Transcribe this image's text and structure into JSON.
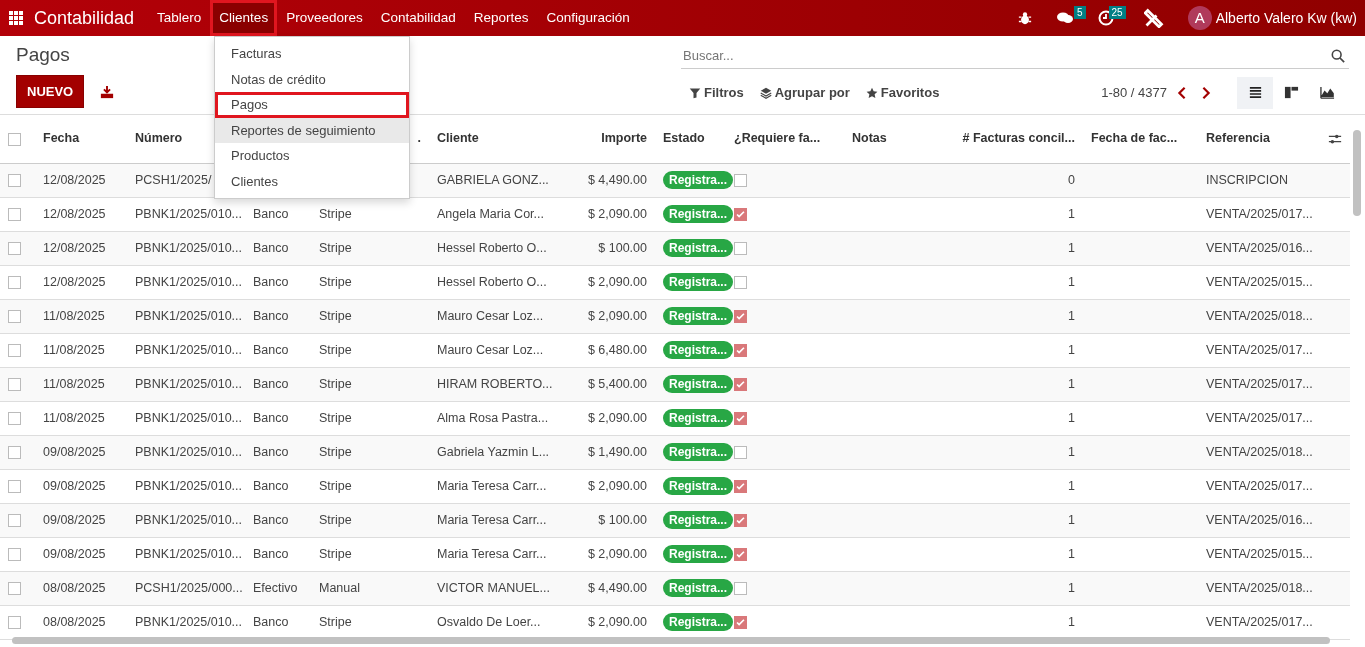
{
  "navbar": {
    "app_title": "Contabilidad",
    "menu": [
      {
        "label": "Tablero",
        "selected": false,
        "highlighted": false
      },
      {
        "label": "Clientes",
        "selected": true,
        "highlighted": true
      },
      {
        "label": "Proveedores",
        "selected": false,
        "highlighted": false
      },
      {
        "label": "Contabilidad",
        "selected": false,
        "highlighted": false
      },
      {
        "label": "Reportes",
        "selected": false,
        "highlighted": false
      },
      {
        "label": "Configuración",
        "selected": false,
        "highlighted": false
      }
    ],
    "messages_badge": "5",
    "activities_badge": "25",
    "avatar_initial": "A",
    "user": "Alberto Valero Kw (kw)"
  },
  "dropdown": {
    "items": [
      {
        "label": "Facturas",
        "hovered": false,
        "highlighted": false
      },
      {
        "label": "Notas de crédito",
        "hovered": false,
        "highlighted": false
      },
      {
        "label": "Pagos",
        "hovered": false,
        "highlighted": true
      },
      {
        "label": "Reportes de seguimiento",
        "hovered": true,
        "highlighted": false
      },
      {
        "label": "Productos",
        "hovered": false,
        "highlighted": false
      },
      {
        "label": "Clientes",
        "hovered": false,
        "highlighted": false
      }
    ]
  },
  "control_panel": {
    "title": "Pagos",
    "new_button": "NUEVO",
    "search": {
      "placeholder": "Buscar..."
    },
    "filters": [
      "Filtros",
      "Agrupar por",
      "Favoritos"
    ],
    "pager": "1-80 / 4377",
    "views": [
      {
        "kind": "list",
        "selected": true
      },
      {
        "kind": "kanban",
        "selected": false
      },
      {
        "kind": "graph",
        "selected": false
      }
    ]
  },
  "table": {
    "all_selected": false,
    "columns": [
      "Fecha",
      "Número",
      "",
      ".",
      "Cliente",
      "Importe",
      "Estado",
      "¿Requiere fa...",
      "Notas",
      "# Facturas concil...",
      "Fecha de fac...",
      "Referencia"
    ],
    "rows": [
      {
        "selected": false,
        "date": "12/08/2025",
        "number": "PCSH1/2025/",
        "journal": "",
        "method": "",
        "client": "GABRIELA GONZ...",
        "amount": "$ 4,490.00",
        "status": "Registra...",
        "requires_invoice": false,
        "reconciled": "0",
        "reference": "INSCRIPCION"
      },
      {
        "selected": false,
        "date": "12/08/2025",
        "number": "PBNK1/2025/010...",
        "journal": "Banco",
        "method": "Stripe",
        "client": "Angela Maria Cor...",
        "amount": "$ 2,090.00",
        "status": "Registra...",
        "requires_invoice": true,
        "reconciled": "1",
        "reference": "VENTA/2025/017..."
      },
      {
        "selected": false,
        "date": "12/08/2025",
        "number": "PBNK1/2025/010...",
        "journal": "Banco",
        "method": "Stripe",
        "client": "Hessel Roberto O...",
        "amount": "$ 100.00",
        "status": "Registra...",
        "requires_invoice": false,
        "reconciled": "1",
        "reference": "VENTA/2025/016..."
      },
      {
        "selected": false,
        "date": "12/08/2025",
        "number": "PBNK1/2025/010...",
        "journal": "Banco",
        "method": "Stripe",
        "client": "Hessel Roberto O...",
        "amount": "$ 2,090.00",
        "status": "Registra...",
        "requires_invoice": false,
        "reconciled": "1",
        "reference": "VENTA/2025/015..."
      },
      {
        "selected": false,
        "date": "11/08/2025",
        "number": "PBNK1/2025/010...",
        "journal": "Banco",
        "method": "Stripe",
        "client": "Mauro Cesar Loz...",
        "amount": "$ 2,090.00",
        "status": "Registra...",
        "requires_invoice": true,
        "reconciled": "1",
        "reference": "VENTA/2025/018..."
      },
      {
        "selected": false,
        "date": "11/08/2025",
        "number": "PBNK1/2025/010...",
        "journal": "Banco",
        "method": "Stripe",
        "client": "Mauro Cesar Loz...",
        "amount": "$ 6,480.00",
        "status": "Registra...",
        "requires_invoice": true,
        "reconciled": "1",
        "reference": "VENTA/2025/017..."
      },
      {
        "selected": false,
        "date": "11/08/2025",
        "number": "PBNK1/2025/010...",
        "journal": "Banco",
        "method": "Stripe",
        "client": "HIRAM ROBERTO...",
        "amount": "$ 5,400.00",
        "status": "Registra...",
        "requires_invoice": true,
        "reconciled": "1",
        "reference": "VENTA/2025/017..."
      },
      {
        "selected": false,
        "date": "11/08/2025",
        "number": "PBNK1/2025/010...",
        "journal": "Banco",
        "method": "Stripe",
        "client": "Alma Rosa Pastra...",
        "amount": "$ 2,090.00",
        "status": "Registra...",
        "requires_invoice": true,
        "reconciled": "1",
        "reference": "VENTA/2025/017..."
      },
      {
        "selected": false,
        "date": "09/08/2025",
        "number": "PBNK1/2025/010...",
        "journal": "Banco",
        "method": "Stripe",
        "client": "Gabriela Yazmin L...",
        "amount": "$ 1,490.00",
        "status": "Registra...",
        "requires_invoice": false,
        "reconciled": "1",
        "reference": "VENTA/2025/018..."
      },
      {
        "selected": false,
        "date": "09/08/2025",
        "number": "PBNK1/2025/010...",
        "journal": "Banco",
        "method": "Stripe",
        "client": "Maria Teresa Carr...",
        "amount": "$ 2,090.00",
        "status": "Registra...",
        "requires_invoice": true,
        "reconciled": "1",
        "reference": "VENTA/2025/017..."
      },
      {
        "selected": false,
        "date": "09/08/2025",
        "number": "PBNK1/2025/010...",
        "journal": "Banco",
        "method": "Stripe",
        "client": "Maria Teresa Carr...",
        "amount": "$ 100.00",
        "status": "Registra...",
        "requires_invoice": true,
        "reconciled": "1",
        "reference": "VENTA/2025/016..."
      },
      {
        "selected": false,
        "date": "09/08/2025",
        "number": "PBNK1/2025/010...",
        "journal": "Banco",
        "method": "Stripe",
        "client": "Maria Teresa Carr...",
        "amount": "$ 2,090.00",
        "status": "Registra...",
        "requires_invoice": true,
        "reconciled": "1",
        "reference": "VENTA/2025/015..."
      },
      {
        "selected": false,
        "date": "08/08/2025",
        "number": "PCSH1/2025/000...",
        "journal": "Efectivo",
        "method": "Manual",
        "client": "VICTOR MANUEL...",
        "amount": "$ 4,490.00",
        "status": "Registra...",
        "requires_invoice": false,
        "reconciled": "1",
        "reference": "VENTA/2025/018..."
      },
      {
        "selected": false,
        "date": "08/08/2025",
        "number": "PBNK1/2025/010...",
        "journal": "Banco",
        "method": "Stripe",
        "client": "Osvaldo De Loer...",
        "amount": "$ 2,090.00",
        "status": "Registra...",
        "requires_invoice": true,
        "reconciled": "1",
        "reference": "VENTA/2025/017..."
      }
    ]
  }
}
